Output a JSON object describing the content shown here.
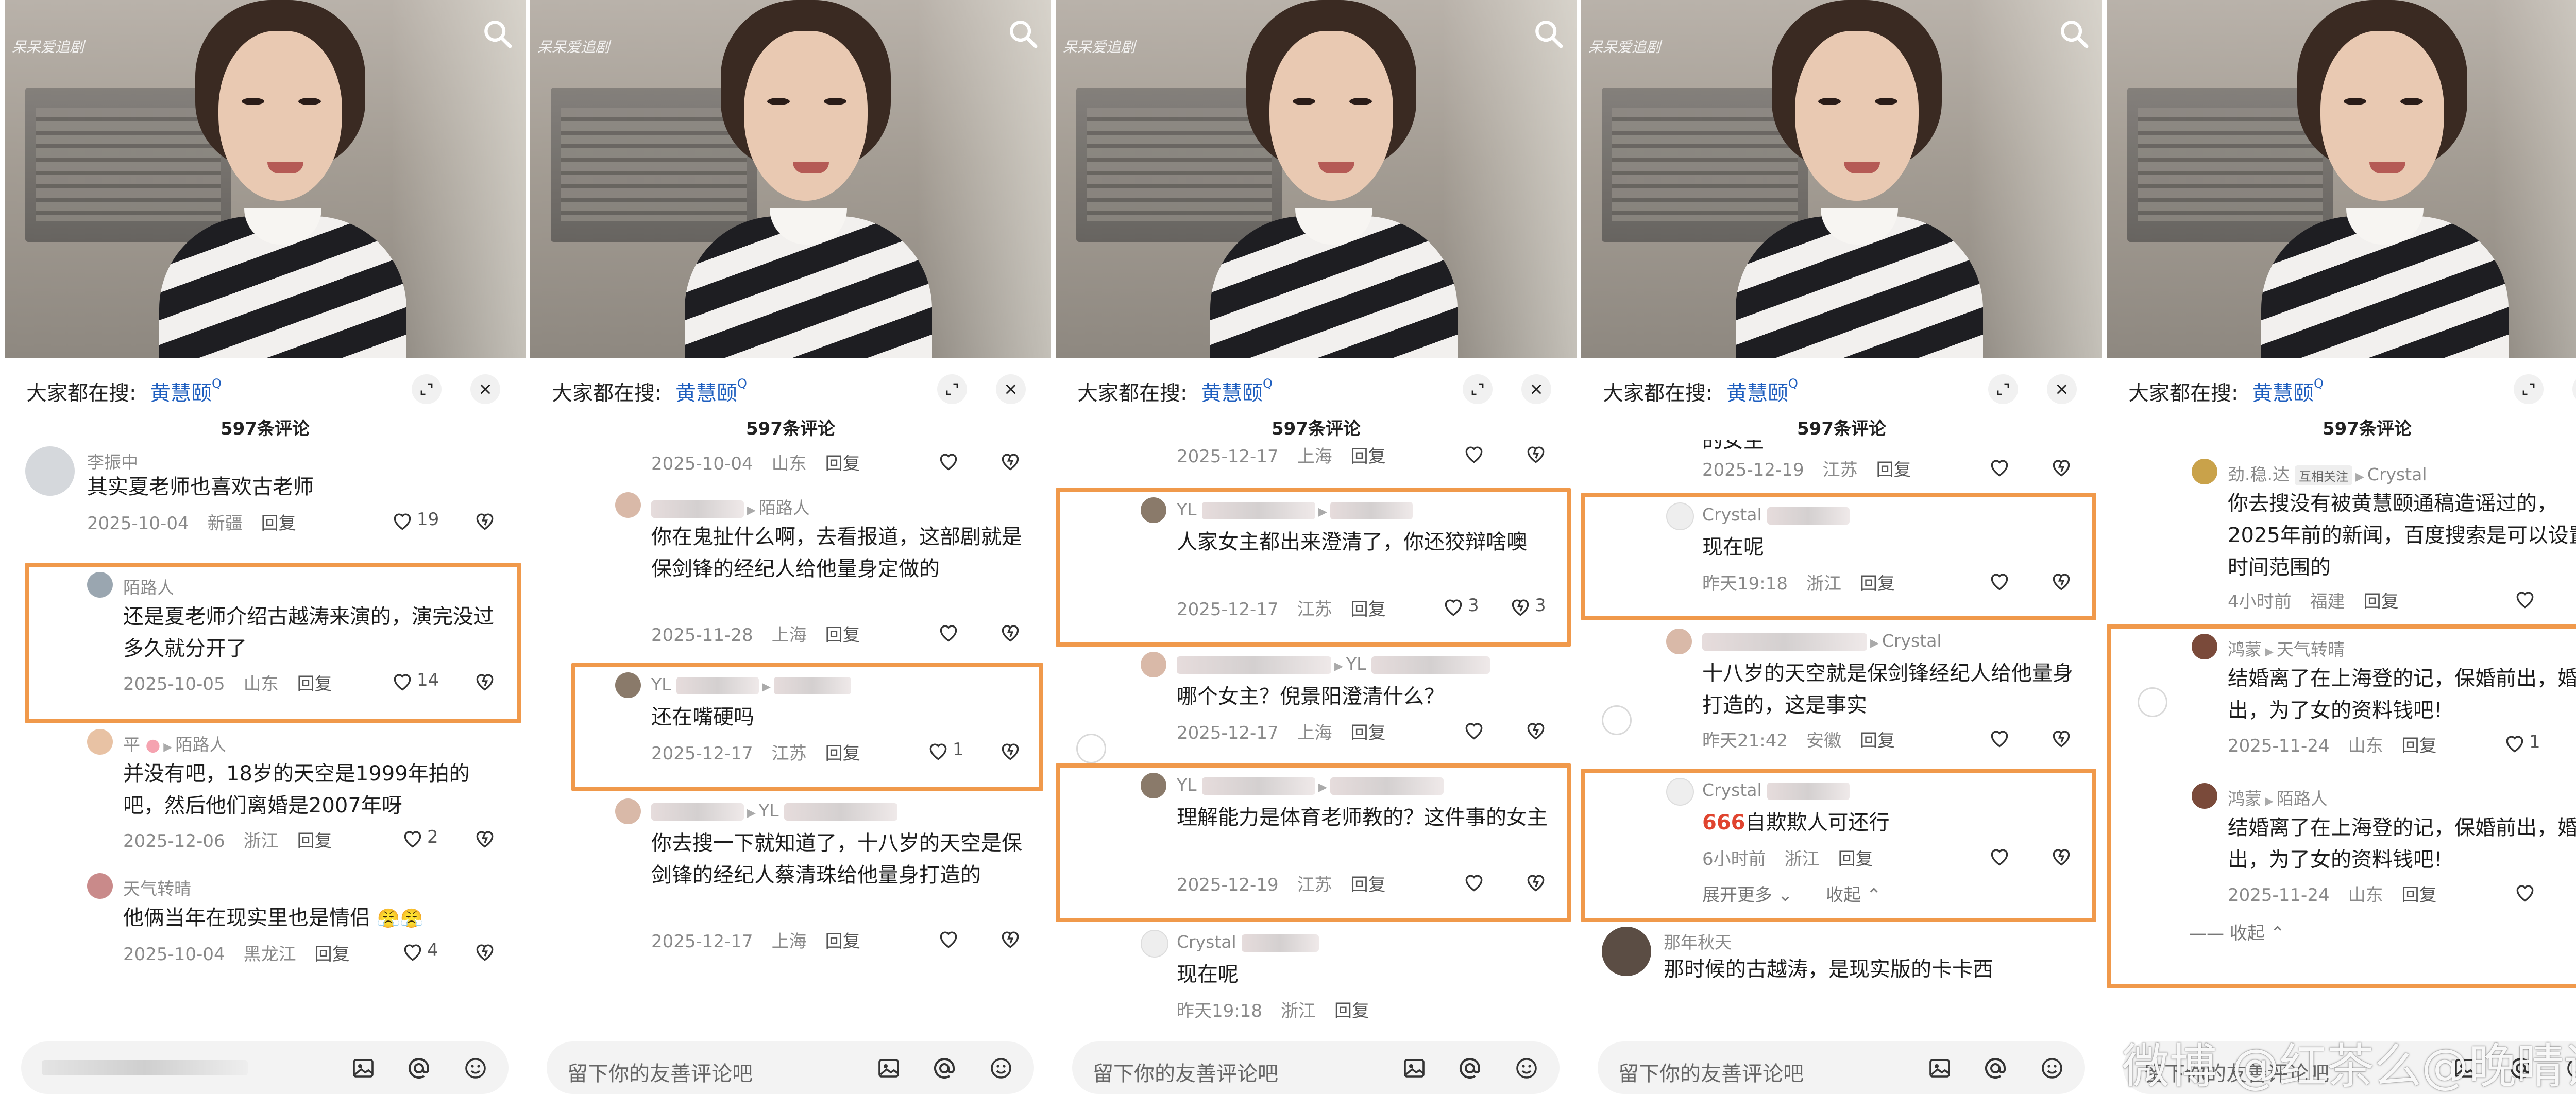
{
  "header": {
    "everyone_searching": "大家都在搜:",
    "hot_term": "黄慧颐",
    "comment_count": "597条评论"
  },
  "video": {
    "watermark": "呆呆爱追剧"
  },
  "input": {
    "placeholder": "留下你的友善评论吧"
  },
  "site_watermark": "微博 @红茶么@晚晴诗",
  "colors": {
    "highlight_box": "#f0994b",
    "link_blue": "#1f5fbf"
  },
  "icons": [
    "search-icon",
    "expand-icon",
    "close-icon",
    "heart-icon",
    "dislike-icon",
    "image-icon",
    "at-icon",
    "emoji-icon"
  ],
  "panels": [
    {
      "comments": [
        {
          "name": "李振中",
          "body": "其实夏老师也喜欢古老师",
          "meta": [
            "2025-10-04",
            "新疆",
            "回复"
          ],
          "likes": "19"
        },
        {
          "name": "陌路人",
          "body": "还是夏老师介绍古越涛来演的，演完没过多久就分开了",
          "meta": [
            "2025-10-05",
            "山东",
            "回复"
          ],
          "likes": "14"
        },
        {
          "name": "平",
          "reply_to": "陌路人",
          "body": "并没有吧，18岁的天空是1999年拍的吧，然后他们离婚是2007年呀",
          "meta": [
            "2025-12-06",
            "浙江",
            "回复"
          ],
          "likes": "2"
        },
        {
          "name": "天气转晴",
          "body": "他俩当年在现实里也是情侣",
          "meta": [
            "2025-10-04",
            "黑龙江",
            "回复"
          ],
          "likes": "4"
        }
      ]
    },
    {
      "comments": [
        {
          "meta": [
            "2025-10-04",
            "山东",
            "回复"
          ]
        },
        {
          "reply_to": "陌路人",
          "body": "你在鬼扯什么啊，去看报道，这部剧就是保剑锋的经纪人给他量身定做的",
          "meta": [
            "2025-11-28",
            "上海",
            "回复"
          ]
        },
        {
          "name": "YL",
          "body": "还在嘴硬吗",
          "meta": [
            "2025-12-17",
            "江苏",
            "回复"
          ],
          "likes": "1"
        },
        {
          "reply_to": "YL",
          "body": "你去搜一下就知道了，十八岁的天空是保剑锋的经纪人蔡清珠给他量身打造的",
          "meta": [
            "2025-12-17",
            "上海",
            "回复"
          ]
        }
      ]
    },
    {
      "comments": [
        {
          "meta": [
            "2025-12-17",
            "上海",
            "回复"
          ]
        },
        {
          "name": "YL",
          "body": "人家女主都出来澄清了，你还狡辩啥噢",
          "meta": [
            "2025-12-17",
            "江苏",
            "回复"
          ],
          "likes": "3",
          "dislikes": "3"
        },
        {
          "reply_to": "YL",
          "body": "哪个女主？倪景阳澄清什么？",
          "meta": [
            "2025-12-17",
            "上海",
            "回复"
          ]
        },
        {
          "name": "YL",
          "body": "理解能力是体育老师教的？这件事的女主",
          "meta": [
            "2025-12-19",
            "江苏",
            "回复"
          ]
        },
        {
          "name": "Crystal",
          "body": "现在呢",
          "meta": [
            "昨天19:18",
            "浙江",
            "回复"
          ]
        }
      ]
    },
    {
      "comments": [
        {
          "body": "的女主",
          "meta": [
            "2025-12-19",
            "江苏",
            "回复"
          ]
        },
        {
          "name": "Crystal",
          "body": "现在呢",
          "meta": [
            "昨天19:18",
            "浙江",
            "回复"
          ]
        },
        {
          "reply_to": "Crystal",
          "body": "十八岁的天空就是保剑锋经纪人给他量身打造的，这是事实",
          "meta": [
            "昨天21:42",
            "安徽",
            "回复"
          ]
        },
        {
          "name": "Crystal",
          "emoji": "666",
          "body": "自欺欺人可还行",
          "meta": [
            "6小时前",
            "浙江",
            "回复"
          ]
        },
        {
          "name": "那年秋天",
          "body": "那时候的古越涛，是现实版的卡卡西"
        }
      ],
      "expand": "展开更多",
      "collapse": "收起"
    },
    {
      "comments": [
        {
          "name": "劲.稳.达",
          "tag": "互相关注",
          "reply_to": "Crystal",
          "body": "你去搜没有被黄慧颐通稿造谣过的，2025年前的新闻，百度搜索是可以设置时间范围的",
          "meta": [
            "4小时前",
            "福建",
            "回复"
          ]
        },
        {
          "name": "鸿蒙",
          "reply_to": "天气转晴",
          "body": "结婚离了在上海登的记，保婚前出，婚后出，为了女的资料钱吧!",
          "meta": [
            "2025-11-24",
            "山东",
            "回复"
          ],
          "likes": "1"
        },
        {
          "name": "鸿蒙",
          "reply_to": "陌路人",
          "body": "结婚离了在上海登的记，保婚前出，婚后出，为了女的资料钱吧!",
          "meta": [
            "2025-11-24",
            "山东",
            "回复"
          ]
        }
      ],
      "collapse": "收起"
    }
  ]
}
